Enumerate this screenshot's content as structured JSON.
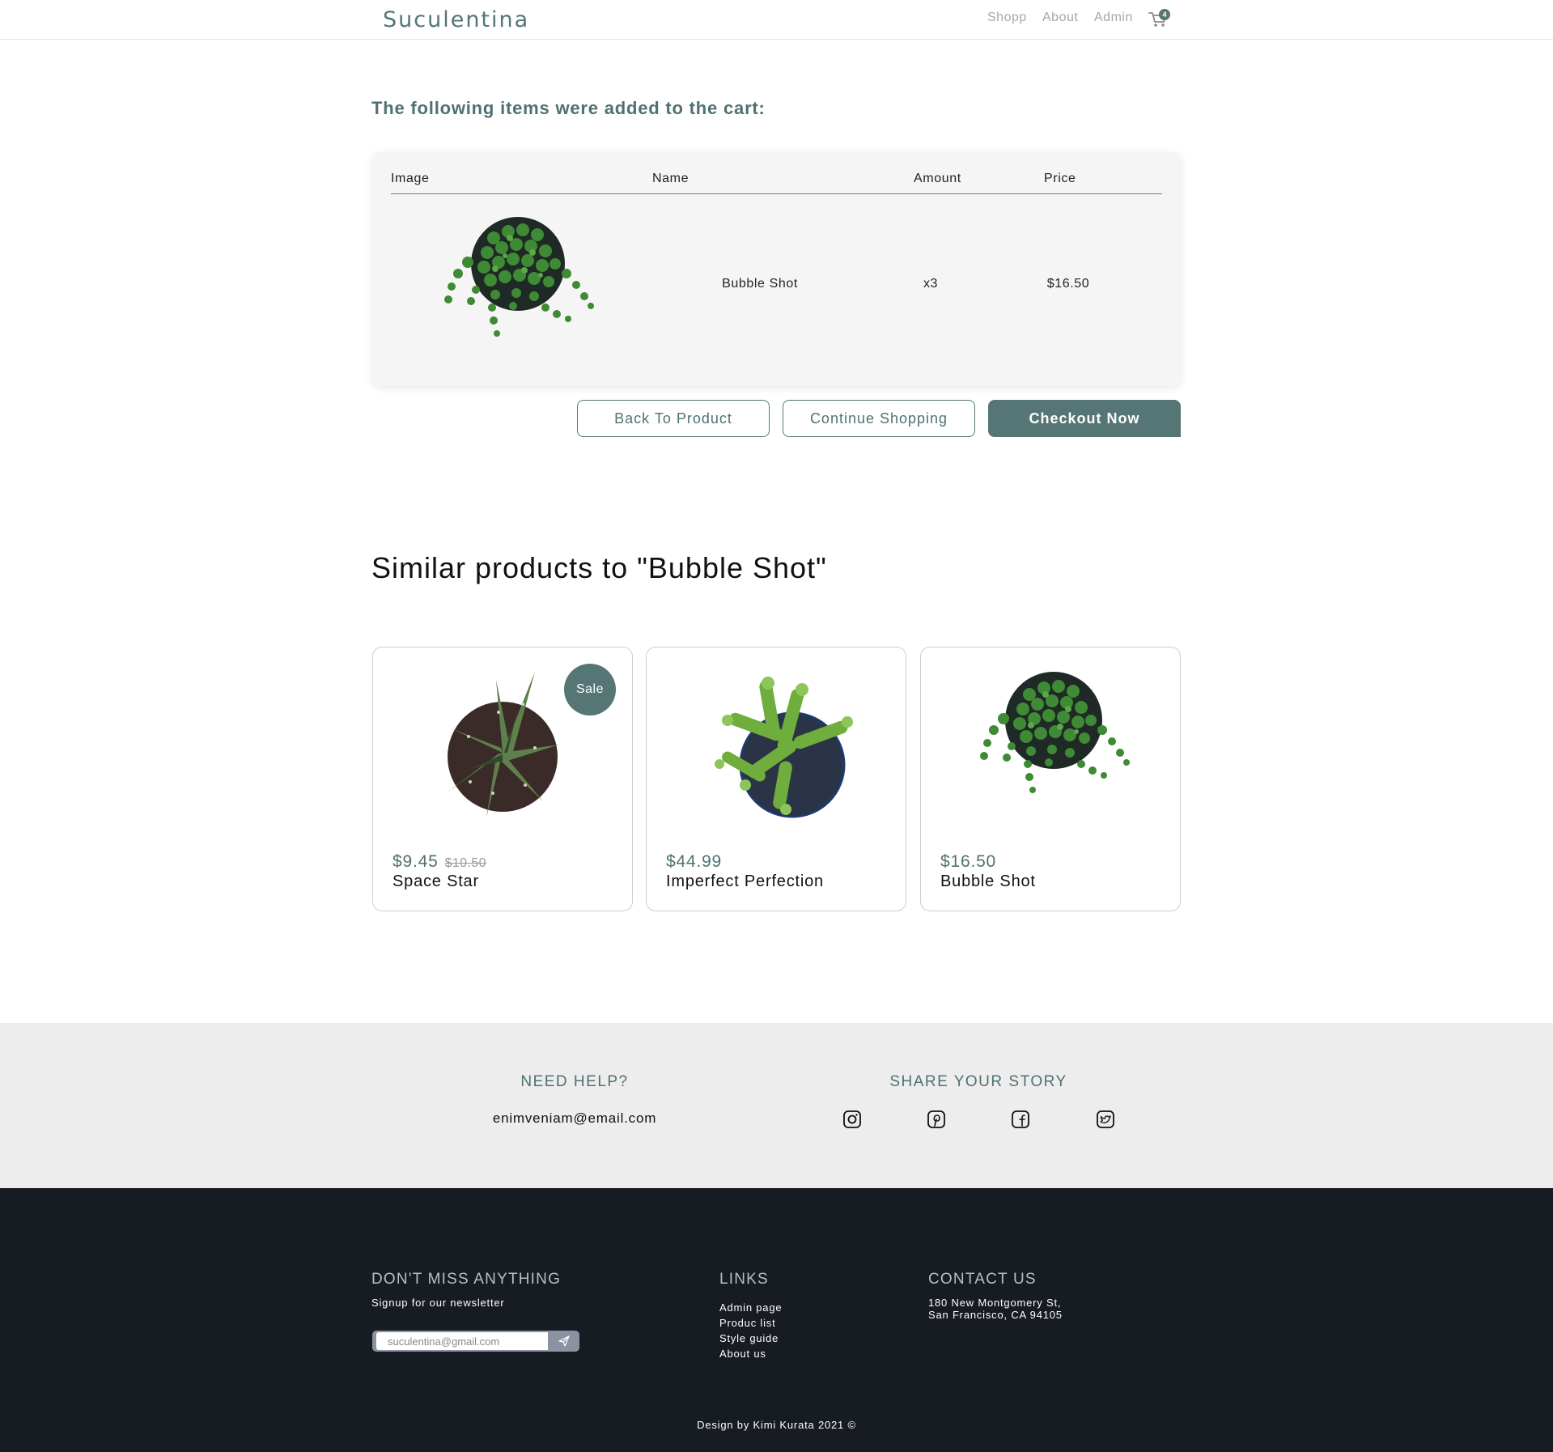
{
  "header": {
    "logo": "Suculentina",
    "nav": {
      "shopp": "Shopp",
      "about": "About",
      "admin": "Admin"
    },
    "cart_count": "4"
  },
  "cart": {
    "heading": "The following items were added to the cart:",
    "columns": {
      "image": "Image",
      "name": "Name",
      "amount": "Amount",
      "price": "Price"
    },
    "items": [
      {
        "name": "Bubble Shot",
        "amount": "x3",
        "price": "$16.50"
      }
    ],
    "buttons": {
      "back": "Back To Product",
      "continue": "Continue Shopping",
      "checkout": "Checkout Now"
    }
  },
  "similar": {
    "heading": "Similar products to \"Bubble Shot\"",
    "products": [
      {
        "name": "Space Star",
        "price": "$9.45",
        "old_price": "$10.50",
        "badge": "Sale"
      },
      {
        "name": "Imperfect Perfection",
        "price": "$44.99"
      },
      {
        "name": "Bubble Shot",
        "price": "$16.50"
      }
    ]
  },
  "help": {
    "title": "NEED HELP?",
    "email": "enimveniam@email.com",
    "share_title": "SHARE YOUR STORY",
    "social_icons": [
      "instagram-icon",
      "pinterest-icon",
      "facebook-icon",
      "twitter-icon"
    ]
  },
  "footer": {
    "newsletter_title": "DON'T MISS ANYTHING",
    "newsletter_sub": "Signup for our newsletter",
    "newsletter_placeholder": "suculentina@gmail.com",
    "links_title": "LINKS",
    "links": [
      "Admin page",
      "Produc list",
      "Style guide",
      "About us"
    ],
    "contact_title": "CONTACT US",
    "contact_line1": "180 New Montgomery St,",
    "contact_line2": "San Francisco, CA 94105",
    "credit": "Design by Kimi Kurata 2021 ©"
  },
  "colors": {
    "accent": "#567575",
    "accent_text": "#4f7171",
    "help_band": "#ededed",
    "footer_bg": "#171b22"
  }
}
